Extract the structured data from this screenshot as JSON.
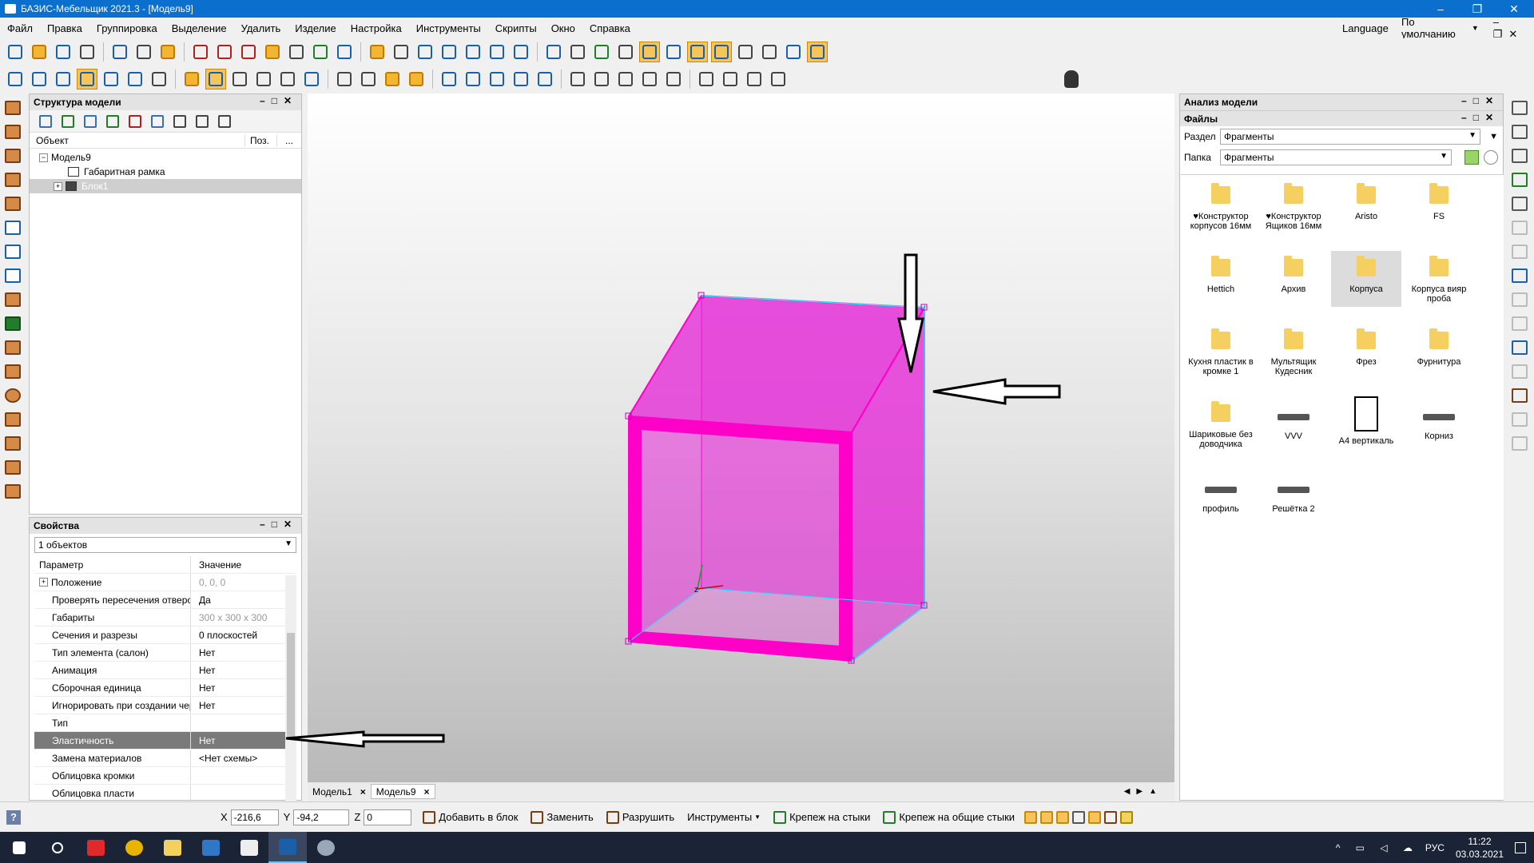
{
  "window": {
    "title": "БАЗИС-Мебельщик 2021.3 - [Модель9]",
    "minimize": "–",
    "maximize": "❐",
    "close": "✕"
  },
  "menu": {
    "items": [
      "Файл",
      "Правка",
      "Группировка",
      "Выделение",
      "Удалить",
      "Изделие",
      "Настройка",
      "Инструменты",
      "Скрипты",
      "Окно",
      "Справка"
    ],
    "language": "Language",
    "preset": "По умолчанию"
  },
  "structure_panel": {
    "title": "Структура модели",
    "col_object": "Объект",
    "col_pos": "Поз.",
    "col_more": "...",
    "tree": [
      {
        "label": "Модель9",
        "expander": "−"
      },
      {
        "label": "Габаритная рамка"
      },
      {
        "label": "Блок1",
        "expander": "+"
      }
    ]
  },
  "properties_panel": {
    "title": "Свойства",
    "selection": "1 объектов",
    "col_param": "Параметр",
    "col_value": "Значение",
    "rows": [
      {
        "name": "Положение",
        "value": "0, 0, 0",
        "expander": "+"
      },
      {
        "name": "Проверять пересечения отверсти",
        "value": "Да"
      },
      {
        "name": "Габариты",
        "value": "300 x 300 x 300"
      },
      {
        "name": "Сечения и разрезы",
        "value": "0 плоскостей"
      },
      {
        "name": "Тип элемента (салон)",
        "value": "Нет"
      },
      {
        "name": "Анимация",
        "value": "Нет"
      },
      {
        "name": "Сборочная единица",
        "value": "Нет"
      },
      {
        "name": "Игнорировать при создании черте",
        "value": "Нет"
      },
      {
        "name": "Тип",
        "value": ""
      },
      {
        "name": "Эластичность",
        "value": "Нет"
      },
      {
        "name": "Замена материалов",
        "value": "<Нет схемы>"
      },
      {
        "name": "Облицовка кромки",
        "value": ""
      },
      {
        "name": "Облицовка пласти",
        "value": ""
      }
    ]
  },
  "view_tabs": [
    {
      "label": "Модель1",
      "close": "×"
    },
    {
      "label": "Модель9",
      "close": "×"
    }
  ],
  "analysis_panel": {
    "title": "Анализ модели",
    "files_title": "Файлы",
    "section_label": "Раздел",
    "section_value": "Фрагменты",
    "folder_label": "Папка",
    "folder_value": "Фрагменты",
    "items": [
      {
        "label": "♥Конструктор корпусов 16мм",
        "icon": "folder-icon"
      },
      {
        "label": "♥Конструктор Ящиков 16мм",
        "icon": "folder-icon"
      },
      {
        "label": "Aristo",
        "icon": "folder-icon"
      },
      {
        "label": "FS",
        "icon": "folder-icon"
      },
      {
        "label": "Hettich",
        "icon": "folder-icon"
      },
      {
        "label": "Архив",
        "icon": "folder-icon"
      },
      {
        "label": "Корпуса",
        "icon": "folder-icon"
      },
      {
        "label": "Корпуса вияр проба",
        "icon": "folder-icon"
      },
      {
        "label": "Кухня пластик в кромке 1",
        "icon": "folder-icon"
      },
      {
        "label": "Мультящик Кудесник",
        "icon": "folder-icon"
      },
      {
        "label": "Фрез",
        "icon": "folder-icon"
      },
      {
        "label": "Фурнитура",
        "icon": "folder-icon"
      },
      {
        "label": "Шариковые без доводчика",
        "icon": "folder-icon"
      },
      {
        "label": "VVV",
        "icon": "fragment-icon"
      },
      {
        "label": "А4 вертикаль",
        "icon": "page-icon"
      },
      {
        "label": "Корниз",
        "icon": "fragment-icon"
      },
      {
        "label": "профиль",
        "icon": "profile-icon"
      },
      {
        "label": "Решётка 2",
        "icon": "fragment-icon"
      }
    ]
  },
  "statusbar": {
    "x_label": "X",
    "x_value": "-216,6",
    "y_label": "Y",
    "y_value": "-94,2",
    "z_label": "Z",
    "z_value": "0",
    "add_to_block": "Добавить в блок",
    "replace": "Заменить",
    "destroy": "Разрушить",
    "tools": "Инструменты",
    "fastener_joints": "Крепеж на стыки",
    "fastener_common_joints": "Крепеж на общие стыки"
  },
  "taskbar": {
    "language": "РУС",
    "time": "11:22",
    "date": "03.03.2021"
  },
  "colors": {
    "titlebar": "#0b6fce",
    "model_fill": "#e51fd6",
    "model_edge": "#ff00c8",
    "bbox_edge": "#33e0ff",
    "taskbar": "#1b2436"
  }
}
